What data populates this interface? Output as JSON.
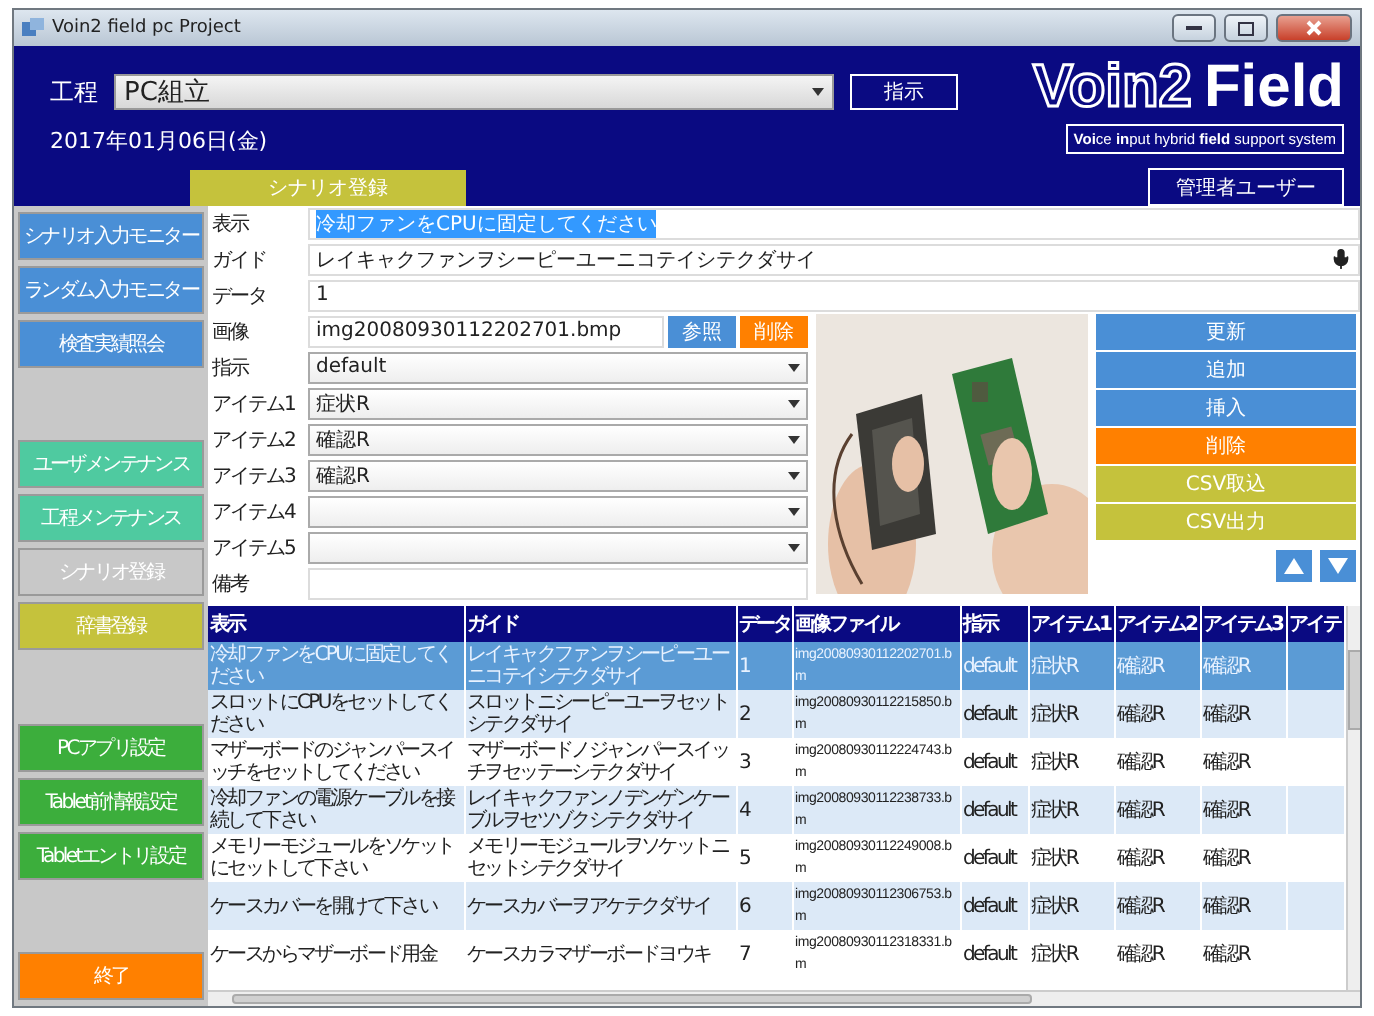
{
  "window": {
    "title": "Voin2 field pc Project"
  },
  "header": {
    "process_label": "工程",
    "process_value": "PC組立",
    "instruct_button": "指示",
    "date": "2017年01月06日(金)",
    "tab": "シナリオ登録",
    "logo": {
      "mark": "Voin2",
      "word": "Field"
    },
    "tagline": "**Voi**ce **in**put hybrid **field** support system",
    "user_button": "管理者ユーザー"
  },
  "sidebar": {
    "items": [
      {
        "kind": "button",
        "label": "シナリオ入力モニター",
        "color": "#4a8fd6"
      },
      {
        "kind": "button",
        "label": "ランダム入力モニター",
        "color": "#4a8fd6"
      },
      {
        "kind": "button",
        "label": "検査実績照会",
        "color": "#4a8fd6"
      },
      {
        "kind": "spacer"
      },
      {
        "kind": "button",
        "label": "ユーザメンテナンス",
        "color": "#4fcaa0"
      },
      {
        "kind": "button",
        "label": "工程メンテナンス",
        "color": "#4fcaa0"
      },
      {
        "kind": "button",
        "label": "シナリオ登録",
        "color": "#c8c8c8"
      },
      {
        "kind": "button",
        "label": "辞書登録",
        "color": "#c5c23c"
      },
      {
        "kind": "spacer"
      },
      {
        "kind": "button",
        "label": "PCアプリ設定",
        "color": "#3cae3c"
      },
      {
        "kind": "button",
        "label": "Tablet前情報設定",
        "color": "#3cae3c"
      },
      {
        "kind": "button",
        "label": "Tabletエントリ設定",
        "color": "#3cae3c"
      },
      {
        "kind": "spacer"
      },
      {
        "kind": "button",
        "label": "終了",
        "color": "#ff8000"
      }
    ]
  },
  "form": {
    "top_fields": [
      {
        "kind": "text",
        "label": "表示",
        "value": "冷却ファンをCPUに固定してください",
        "text_selected": true
      },
      {
        "kind": "voice",
        "label": "ガイド",
        "value": "レイキャクファンヲシーピーユーニコテイシテクダサイ",
        "text_selected": false
      },
      {
        "kind": "text",
        "label": "データ",
        "value": "1",
        "text_selected": false
      }
    ],
    "image": {
      "label": "画像",
      "value": "img20080930112202701.bmp",
      "buttons": [
        {
          "label": "参照",
          "color": "#4a8fd6"
        },
        {
          "label": "削除",
          "color": "#ff8000"
        }
      ]
    },
    "selects": [
      {
        "label": "指示",
        "value": "default"
      },
      {
        "label": "アイテム1",
        "value": "症状R"
      },
      {
        "label": "アイテム2",
        "value": "確認R"
      },
      {
        "label": "アイテム3",
        "value": "確認R"
      },
      {
        "label": "アイテム4"
      },
      {
        "label": "アイテム5"
      }
    ],
    "note": {
      "label": "備考"
    }
  },
  "side_buttons": [
    {
      "label": "更新",
      "color": "#4a8fd6"
    },
    {
      "label": "追加",
      "color": "#4a8fd6"
    },
    {
      "label": "挿入",
      "color": "#4a8fd6"
    },
    {
      "label": "削除",
      "color": "#ff8000"
    },
    {
      "label": "CSV取込",
      "color": "#c5c23c"
    },
    {
      "label": "CSV出力",
      "color": "#c5c23c"
    }
  ],
  "table": {
    "columns": [
      "表示",
      "ガイド",
      "データ",
      "画像ファイル",
      "指示",
      "アイテム1",
      "アイテム2",
      "アイテム3",
      "アイテ"
    ],
    "rows": [
      {
        "selected": true,
        "cells": [
          "冷却ファンをCPUに固定してください",
          "レイキャクファンヲシーピーユーニコテイシテクダサイ",
          "1",
          "img20080930112202701.bm",
          "default",
          "症状R",
          "確認R",
          "確認R",
          ""
        ]
      },
      {
        "selected": false,
        "cells": [
          "スロットにCPUをセットしてください",
          "スロットニシーピーユーヲセットシテクダサイ",
          "2",
          "img20080930112215850.bm",
          "default",
          "症状R",
          "確認R",
          "確認R",
          ""
        ]
      },
      {
        "selected": false,
        "cells": [
          "マザーボードのジャンパースイッチをセットしてください",
          "マザーボードノジャンパースイッチヲセッテーシテクダサイ",
          "3",
          "img20080930112224743.bm",
          "default",
          "症状R",
          "確認R",
          "確認R",
          ""
        ]
      },
      {
        "selected": false,
        "cells": [
          "冷却ファンの電源ケーブルを接続して下さい",
          "レイキャクファンノデンゲンケーブルヲセツゾクシテクダサイ",
          "4",
          "img20080930112238733.bm",
          "default",
          "症状R",
          "確認R",
          "確認R",
          ""
        ]
      },
      {
        "selected": false,
        "cells": [
          "メモリーモジュールをソケットにセットして下さい",
          "メモリーモジュールヲソケットニセットシテクダサイ",
          "5",
          "img20080930112249008.bm",
          "default",
          "症状R",
          "確認R",
          "確認R",
          ""
        ]
      },
      {
        "selected": false,
        "cells": [
          "ケースカバーを開けて下さい",
          "ケースカバーヲアケテクダサイ",
          "6",
          "img20080930112306753.bm",
          "default",
          "症状R",
          "確認R",
          "確認R",
          ""
        ]
      },
      {
        "selected": false,
        "cells": [
          "ケースからマザーボード用金",
          "ケースカラマザーボードヨウキ",
          "7",
          "img20080930112318331.bm",
          "default",
          "症状R",
          "確認R",
          "確認R",
          ""
        ]
      }
    ]
  }
}
